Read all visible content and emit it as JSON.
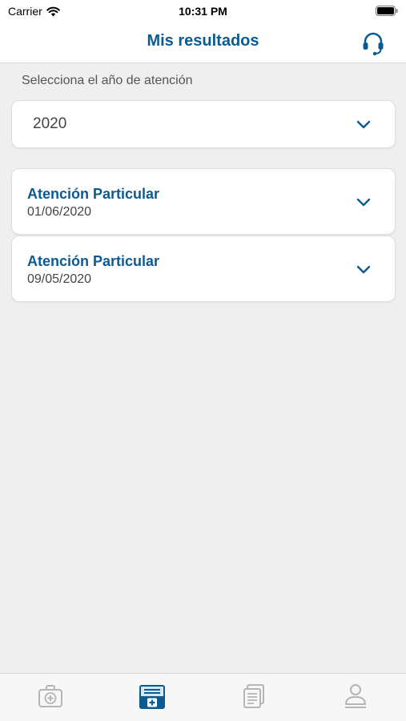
{
  "status_bar": {
    "carrier": "Carrier",
    "time": "10:31 PM"
  },
  "header": {
    "title": "Mis resultados",
    "support_icon": "headset-icon"
  },
  "year_filter": {
    "label": "Selecciona el año de atención",
    "selected": "2020"
  },
  "results": [
    {
      "title": "Atención Particular",
      "date": "01/06/2020"
    },
    {
      "title": "Atención Particular",
      "date": "09/05/2020"
    }
  ],
  "tab_bar": {
    "tabs": [
      {
        "icon": "medical-kit-icon",
        "active": false
      },
      {
        "icon": "medical-record-icon",
        "active": true
      },
      {
        "icon": "documents-icon",
        "active": false
      },
      {
        "icon": "profile-icon",
        "active": false
      }
    ]
  },
  "colors": {
    "accent": "#0b5a91",
    "background": "#efefef",
    "inactive_icon": "#b5b5b5"
  }
}
